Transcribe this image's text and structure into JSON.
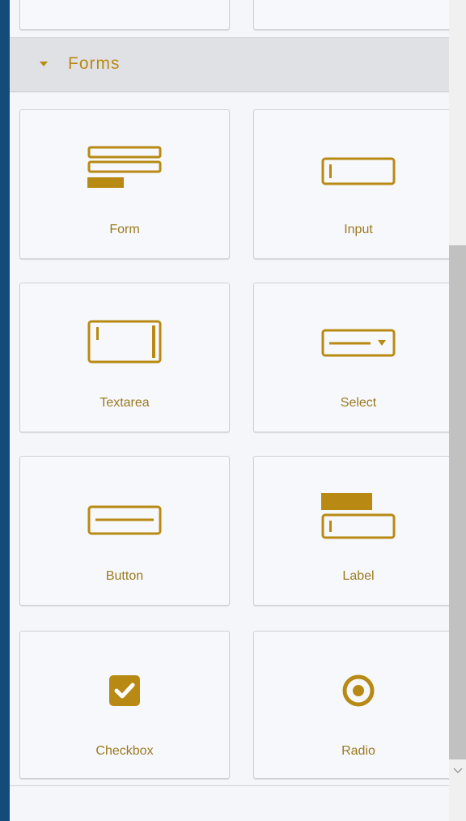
{
  "category": {
    "title": "Forms"
  },
  "blocks": [
    {
      "label": "Form",
      "icon": "form-icon"
    },
    {
      "label": "Input",
      "icon": "input-icon"
    },
    {
      "label": "Textarea",
      "icon": "textarea-icon"
    },
    {
      "label": "Select",
      "icon": "select-icon"
    },
    {
      "label": "Button",
      "icon": "button-icon"
    },
    {
      "label": "Label",
      "icon": "label-icon"
    },
    {
      "label": "Checkbox",
      "icon": "checkbox-icon"
    },
    {
      "label": "Radio",
      "icon": "radio-icon"
    }
  ],
  "colors": {
    "accent": "#b88a14",
    "panel_bg": "#f5f6fa",
    "sidebar_bg": "#154b79",
    "header_bg": "#e0e1e5"
  }
}
